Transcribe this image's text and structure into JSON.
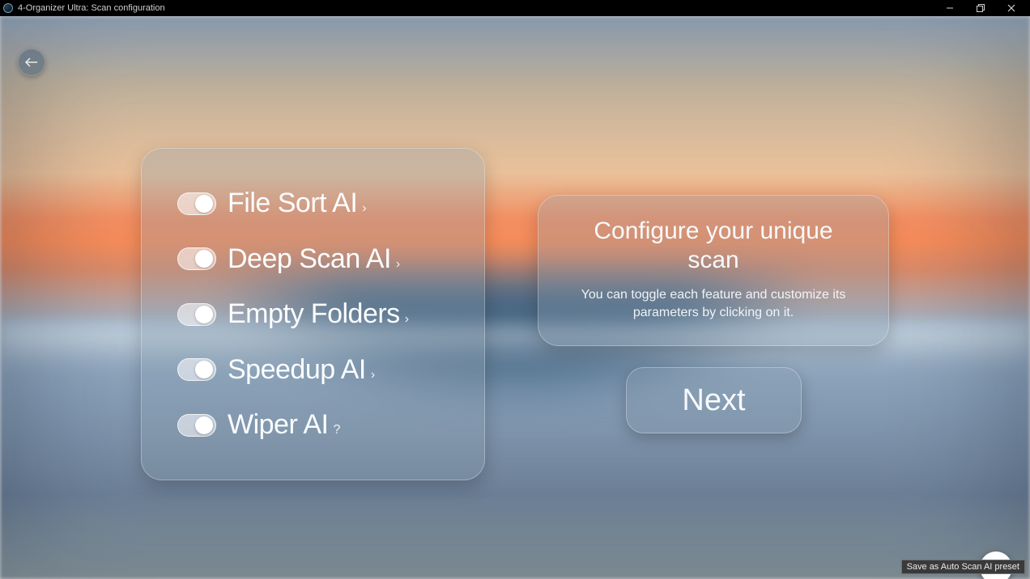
{
  "window": {
    "title": "4-Organizer Ultra: Scan configuration"
  },
  "features": [
    {
      "label": "File Sort AI",
      "suffix": "›",
      "enabled": true
    },
    {
      "label": "Deep Scan AI",
      "suffix": "›",
      "enabled": true
    },
    {
      "label": "Empty Folders",
      "suffix": "›",
      "enabled": true
    },
    {
      "label": "Speedup AI",
      "suffix": "›",
      "enabled": true
    },
    {
      "label": "Wiper AI",
      "suffix": "?",
      "enabled": true
    }
  ],
  "info": {
    "title": "Configure your unique scan",
    "subtitle": "You can toggle each feature and customize its parameters by clicking on it."
  },
  "actions": {
    "next_label": "Next",
    "save_tooltip": "Save as Auto Scan AI preset"
  }
}
